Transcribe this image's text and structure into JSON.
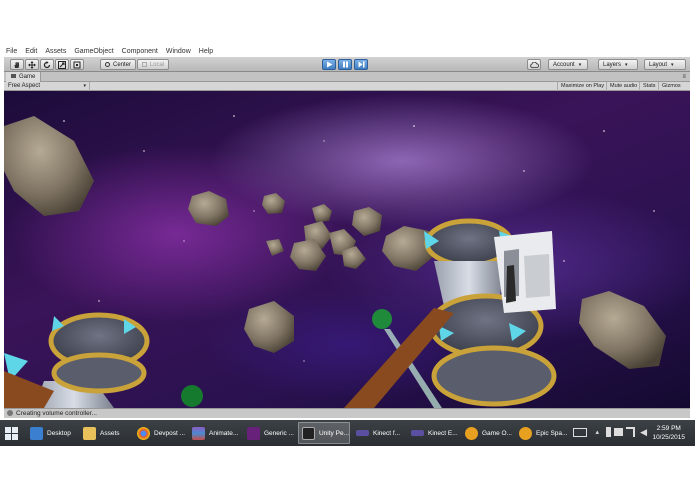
{
  "menu": [
    "File",
    "Edit",
    "Assets",
    "GameObject",
    "Component",
    "Window",
    "Help"
  ],
  "toolbar": {
    "pivot_label": "Center",
    "space_label": "Local",
    "account_label": "Account",
    "layers_label": "Layers",
    "layout_label": "Layout"
  },
  "game_tab": {
    "title": "Game",
    "aspect": "Free Aspect",
    "buttons": [
      "Maximize on Play",
      "Mute audio",
      "Stats",
      "Gizmos"
    ]
  },
  "status": "Creating volume controller...",
  "taskbar": {
    "items": [
      {
        "label": "Desktop",
        "icon": "desktop-icon",
        "color": "#3b7fd0"
      },
      {
        "label": "Assets",
        "icon": "folder-icon",
        "color": "#e8c15a"
      },
      {
        "label": "Devpost ...",
        "icon": "chrome-icon",
        "color": "#dd4b39"
      },
      {
        "label": "Animate...",
        "icon": "winrar-icon",
        "color": "#8b5cc4"
      },
      {
        "label": "Generic ...",
        "icon": "visual-studio-icon",
        "color": "#68217a"
      },
      {
        "label": "Unity Pe...",
        "icon": "unity-icon",
        "color": "#222222"
      },
      {
        "label": "Kinect f...",
        "icon": "kinect-icon",
        "color": "#5a4fa0"
      },
      {
        "label": "Kinect E...",
        "icon": "kinect-icon",
        "color": "#5a4fa0"
      },
      {
        "label": "Game O...",
        "icon": "headphones-icon",
        "color": "#e8a020"
      },
      {
        "label": "Epic Spa...",
        "icon": "headphones-icon",
        "color": "#e8a020"
      }
    ],
    "time": "2:59 PM",
    "date": "10/25/2015"
  }
}
